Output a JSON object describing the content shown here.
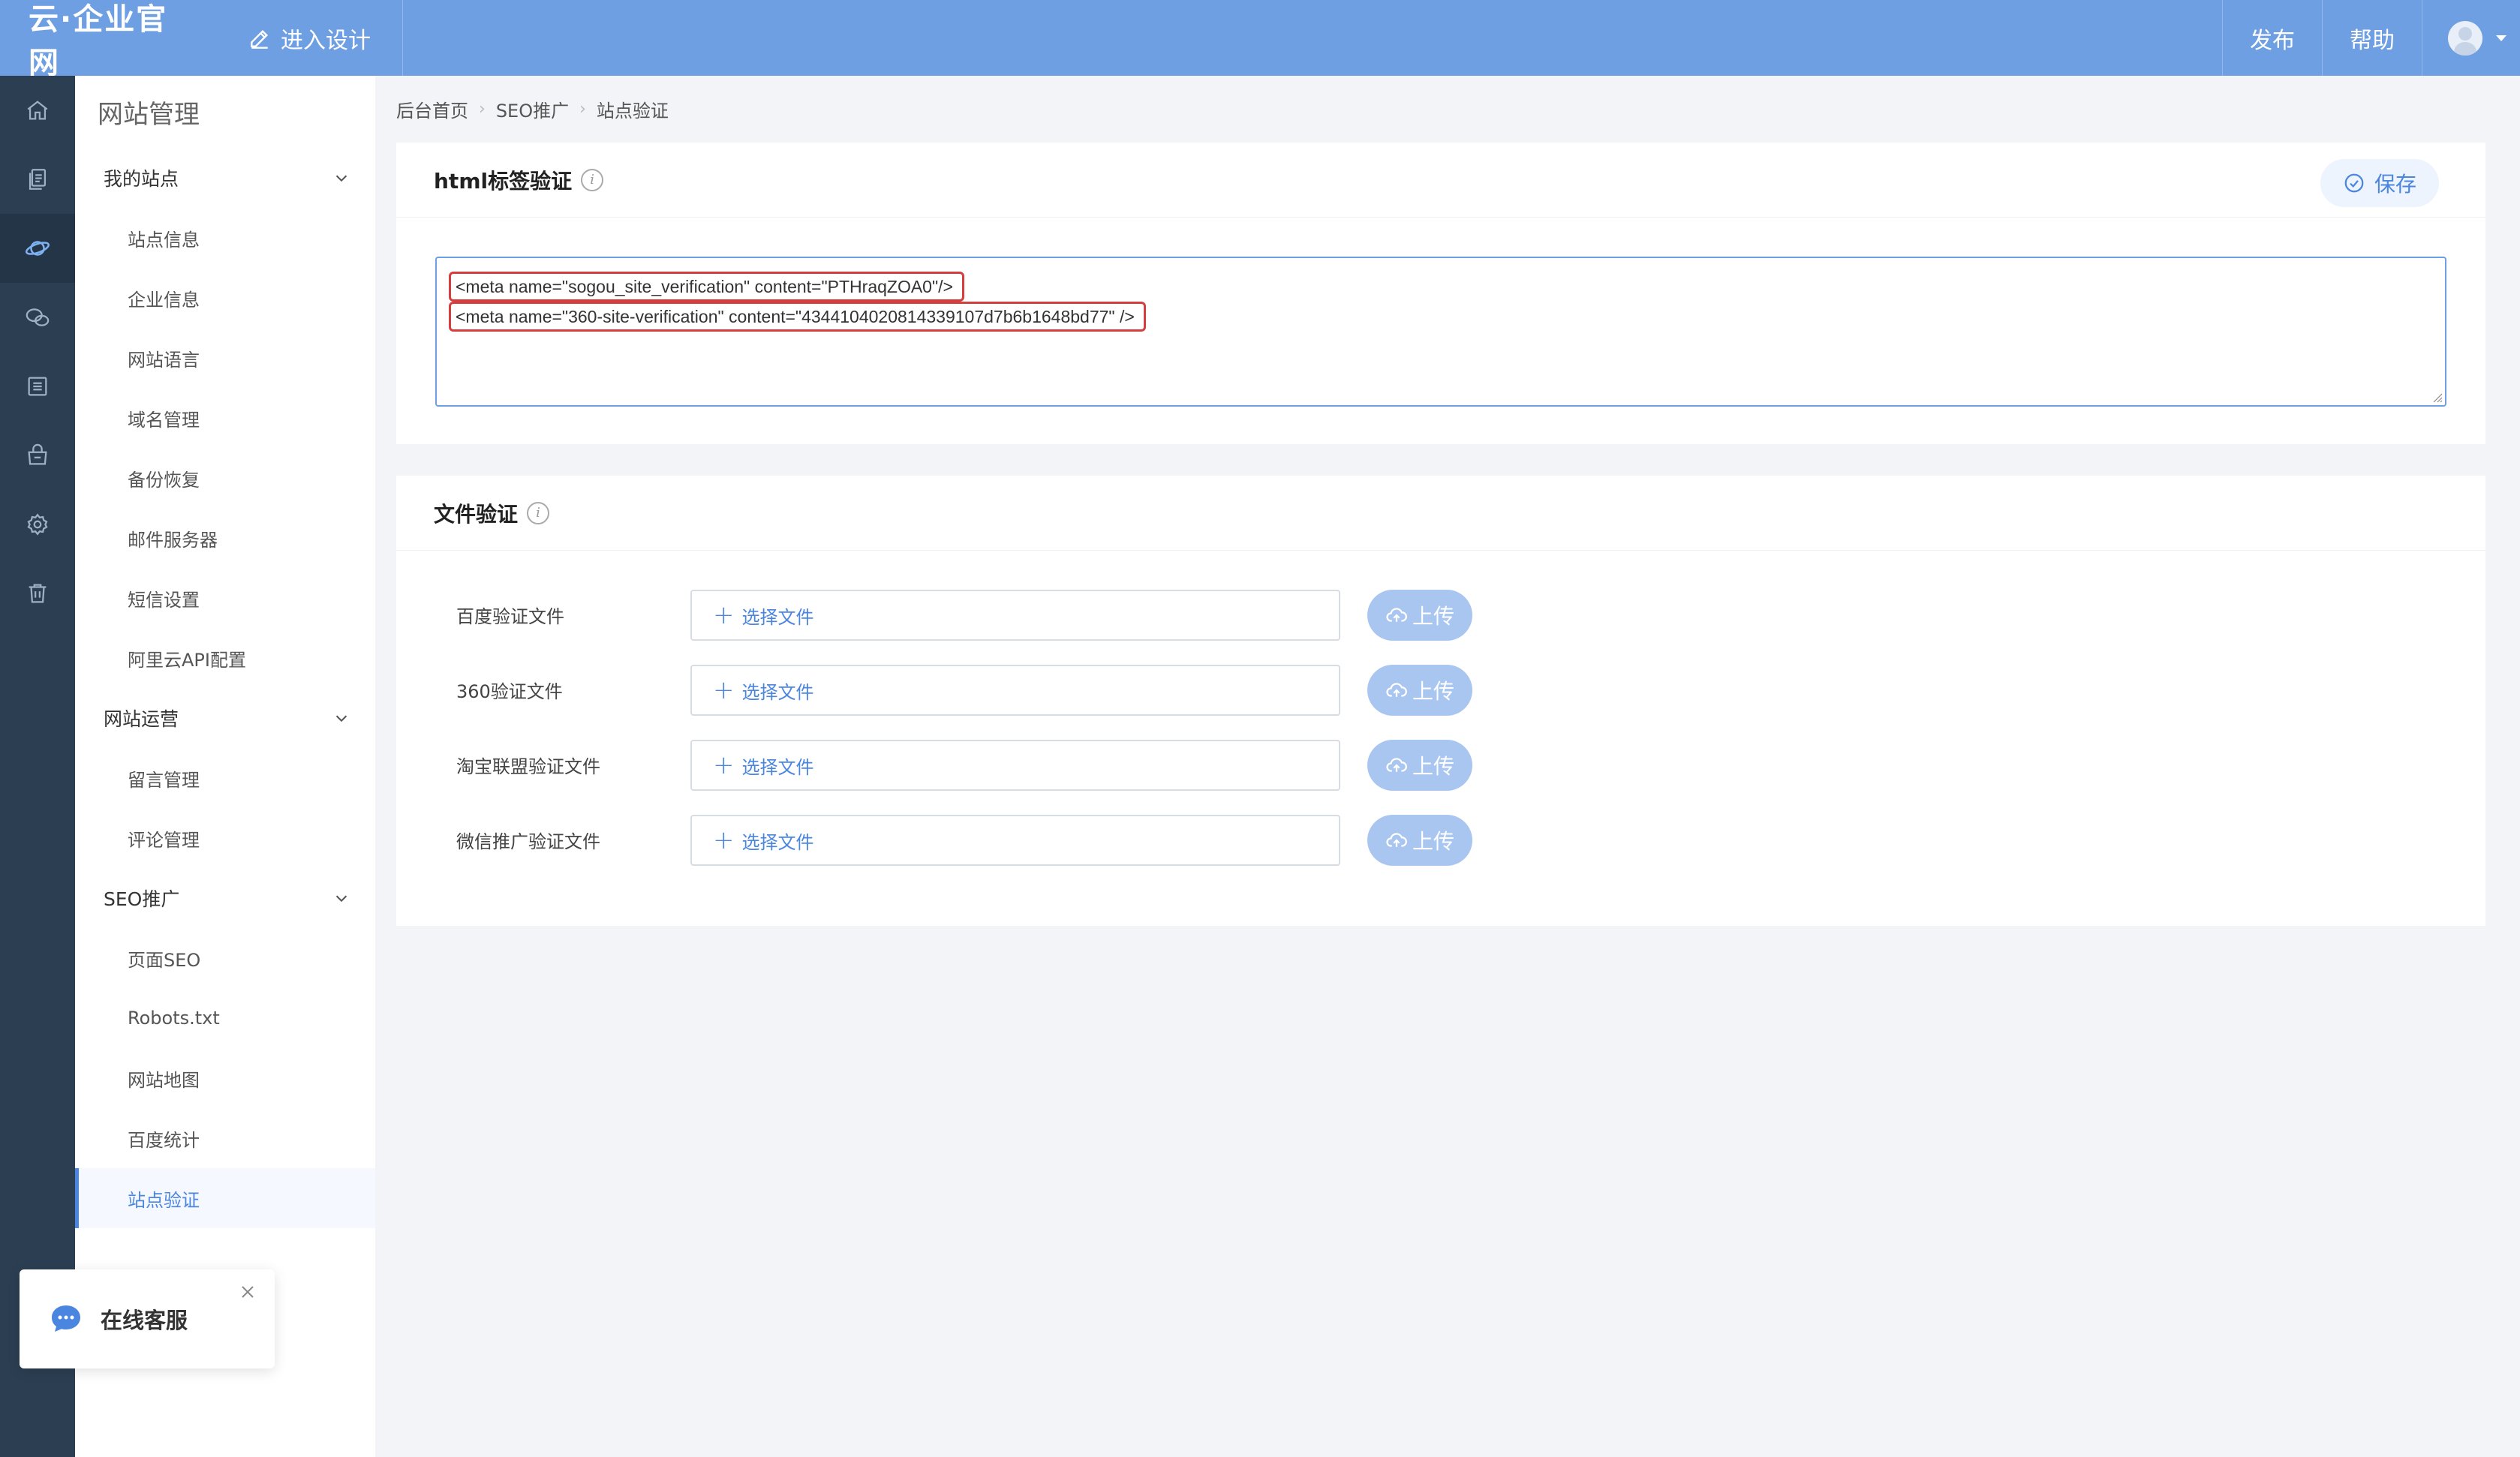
{
  "header": {
    "logo": "云·企业官网",
    "design_label": "进入设计",
    "publish_label": "发布",
    "help_label": "帮助"
  },
  "rail": {
    "icons": [
      "home-icon",
      "pages-icon",
      "planet-icon",
      "wechat-icon",
      "list-icon",
      "shop-icon",
      "settings-icon",
      "trash-icon"
    ],
    "active_index": 2
  },
  "sidebar": {
    "title": "网站管理",
    "groups": [
      {
        "label": "我的站点",
        "items": [
          "站点信息",
          "企业信息",
          "网站语言",
          "域名管理",
          "备份恢复",
          "邮件服务器",
          "短信设置",
          "阿里云API配置"
        ]
      },
      {
        "label": "网站运营",
        "items": [
          "留言管理",
          "评论管理"
        ]
      },
      {
        "label": "SEO推广",
        "items": [
          "页面SEO",
          "Robots.txt",
          "网站地图",
          "百度统计",
          "站点验证"
        ]
      }
    ],
    "active_item": "站点验证"
  },
  "breadcrumb": {
    "items": [
      "后台首页",
      "SEO推广",
      "站点验证"
    ]
  },
  "html_panel": {
    "title": "html标签验证",
    "save_label": "保存",
    "code_lines": [
      "<meta name=\"sogou_site_verification\" content=\"PTHraqZOA0\"/>",
      "<meta name=\"360-site-verification\" content=\"4344104020814339107d7b6b1648bd77\" />"
    ]
  },
  "file_panel": {
    "title": "文件验证",
    "choose_label": "选择文件",
    "upload_label": "上传",
    "rows": [
      {
        "label": "百度验证文件"
      },
      {
        "label": "360验证文件"
      },
      {
        "label": "淘宝联盟验证文件"
      },
      {
        "label": "微信推广验证文件"
      }
    ]
  },
  "chat_widget": {
    "label": "在线客服"
  },
  "colors": {
    "topbar": "#6f9fe3",
    "rail": "#2c3e52",
    "accent": "#4a86e0",
    "highlight": "#d63d3d",
    "upload": "#a9c6f1"
  }
}
